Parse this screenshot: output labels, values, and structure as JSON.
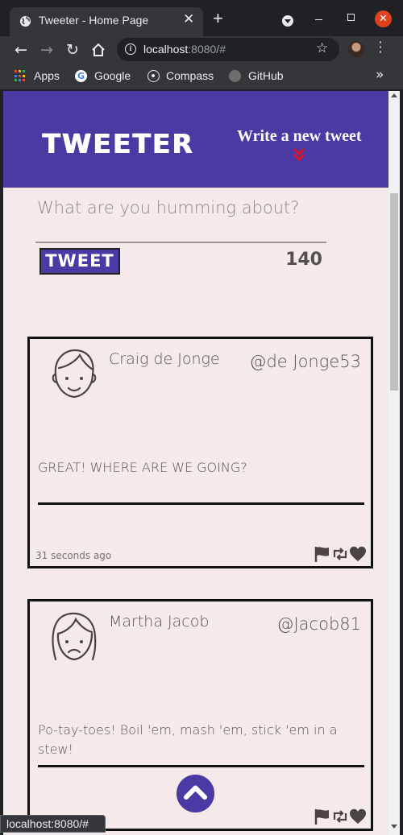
{
  "browser": {
    "tab_title": "Tweeter - Home Page",
    "tab_close": "✕",
    "new_tab": "+",
    "url_host": "localhost",
    "url_rest": ":8080/#",
    "status_url": "localhost:8080/#",
    "bookmarks": [
      {
        "label": "Apps",
        "icon": "apps-grid-icon"
      },
      {
        "label": "Google",
        "icon": "google-icon"
      },
      {
        "label": "Compass",
        "icon": "compass-icon"
      },
      {
        "label": "GitHub",
        "icon": "github-icon"
      }
    ],
    "bookmarks_overflow": "»"
  },
  "nav": {
    "brand": "TWEETER",
    "compose_label": "Write a new tweet",
    "compose_chevron_color": "#e0102b"
  },
  "composer": {
    "placeholder": "What are you humming about?",
    "button_label": "TWEET",
    "counter": "140"
  },
  "tweets": [
    {
      "name": "Craig de Jonge",
      "handle": "@de Jonge53",
      "avatar_icon": "smiling-boy-face-icon",
      "content": "GREAT! WHERE ARE WE GOING?",
      "timestamp": "31 seconds ago"
    },
    {
      "name": "Martha Jacob",
      "handle": "@Jacob81",
      "avatar_icon": "frowning-girl-face-icon",
      "content": "Po-tay-toes! Boil 'em, mash 'em, stick 'em in a stew!",
      "timestamp": ""
    }
  ],
  "colors": {
    "brand_purple": "#4b3aa3",
    "page_background": "#f4eaea",
    "text_gray": "#5b5451"
  }
}
